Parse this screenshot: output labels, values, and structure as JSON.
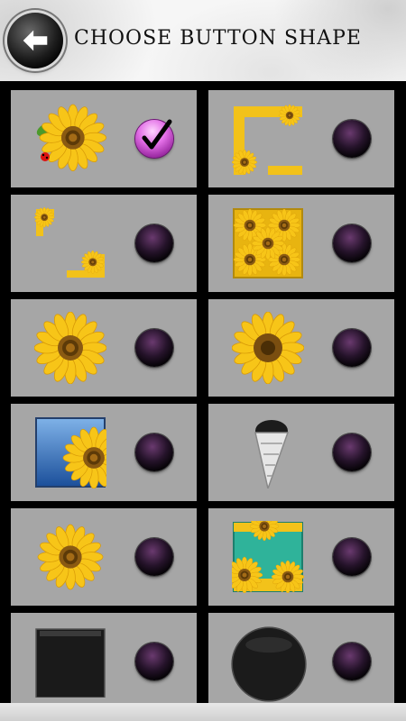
{
  "header": {
    "title": "CHOOSE BUTTON SHAPE",
    "back_icon": "arrow-left-icon"
  },
  "options": [
    {
      "id": "sunflower-ladybug",
      "icon": "sunflower-with-ladybug-icon",
      "selected": true
    },
    {
      "id": "sunflower-frame",
      "icon": "sunflower-border-frame-icon",
      "selected": false
    },
    {
      "id": "sunflower-corners",
      "icon": "sunflower-corner-frame-icon",
      "selected": false
    },
    {
      "id": "sunflower-tile",
      "icon": "sunflower-pattern-tile-icon",
      "selected": false
    },
    {
      "id": "sunflower-flat",
      "icon": "sunflower-icon",
      "selected": false
    },
    {
      "id": "sunflower-round",
      "icon": "sunflower-round-icon",
      "selected": false
    },
    {
      "id": "sunflower-sky",
      "icon": "sunflower-sky-tile-icon",
      "selected": false
    },
    {
      "id": "seed-cone",
      "icon": "sunflower-seeds-cone-icon",
      "selected": false
    },
    {
      "id": "sunflower-small",
      "icon": "sunflower-small-icon",
      "selected": false
    },
    {
      "id": "sunflower-teal",
      "icon": "sunflower-teal-tile-icon",
      "selected": false
    },
    {
      "id": "black-square",
      "icon": "black-square-icon",
      "selected": false
    },
    {
      "id": "black-circle",
      "icon": "black-circle-icon",
      "selected": false
    }
  ],
  "colors": {
    "cell_bg": "#a6a6a6",
    "grid_bg": "#000000",
    "radio_selected": "#e26ee6",
    "radio_unselected": "#25132a",
    "petal": "#f5c518",
    "center": "#8a5a12"
  }
}
